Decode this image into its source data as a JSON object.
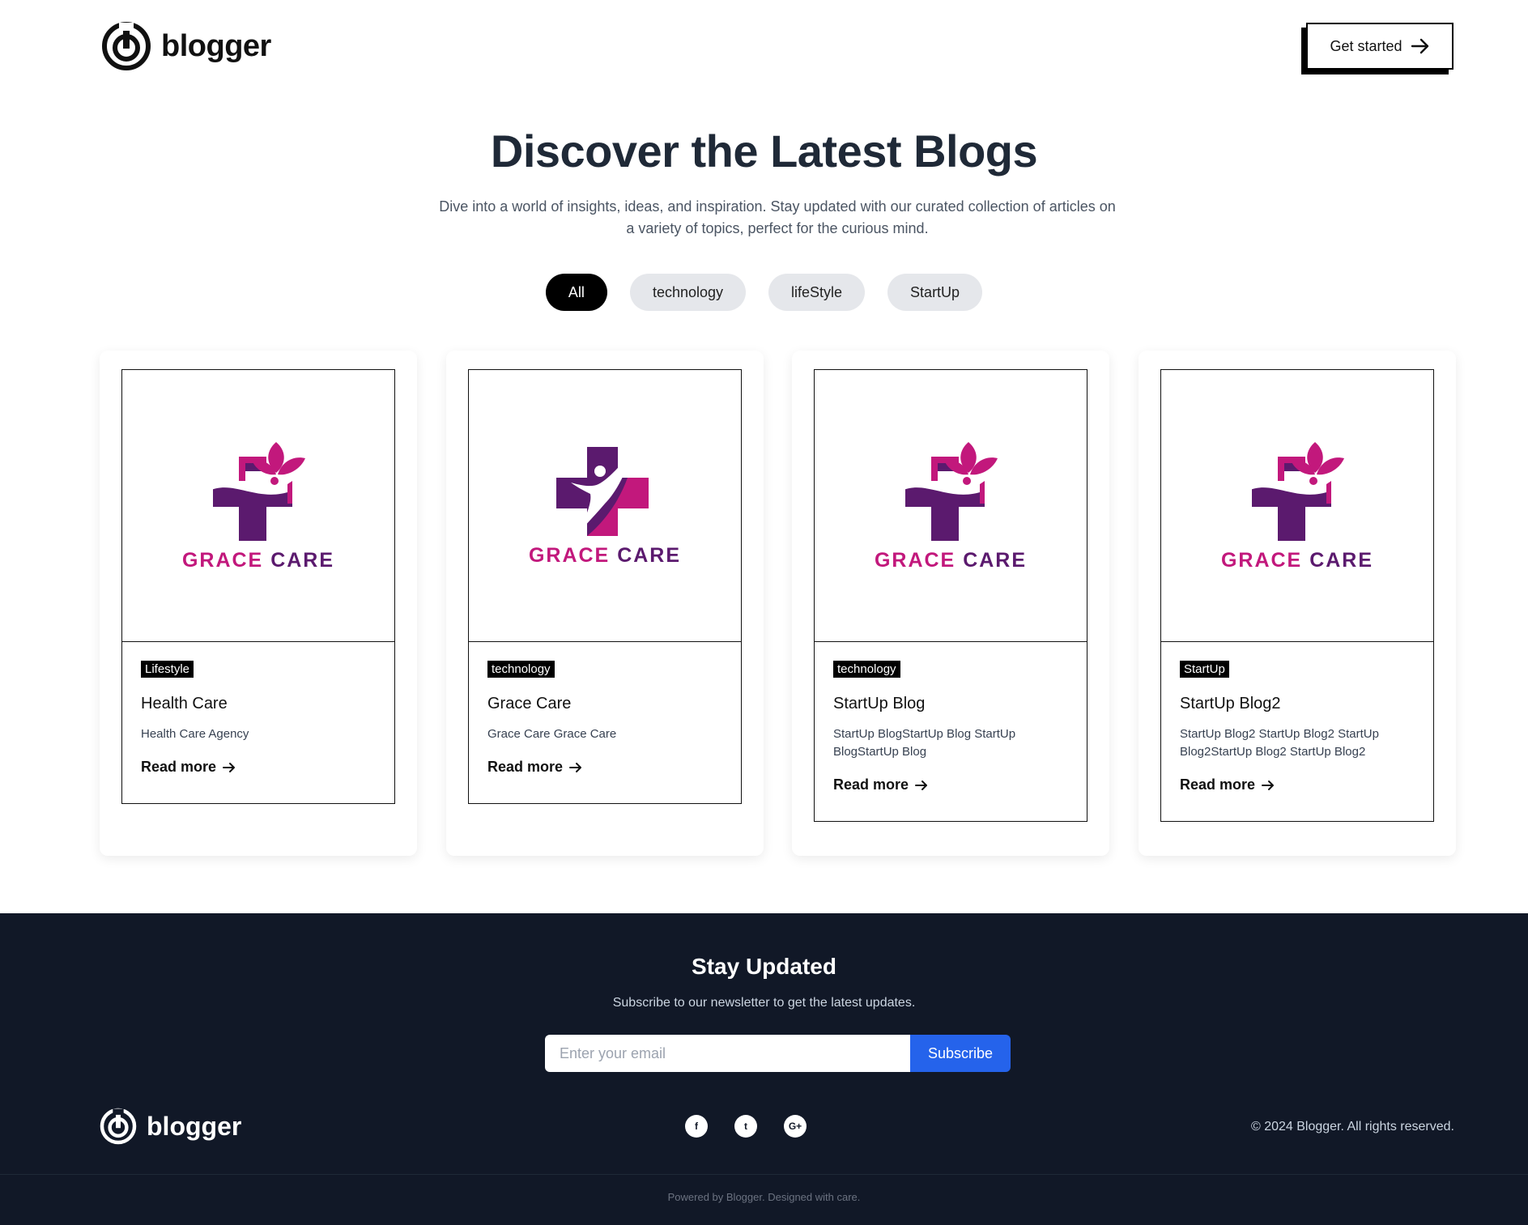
{
  "brand": {
    "name": "blogger"
  },
  "header": {
    "cta_label": "Get started"
  },
  "hero": {
    "title": "Discover the Latest Blogs",
    "subtitle_line1": "Dive into a world of insights, ideas, and inspiration. Stay updated with our curated collection of articles on",
    "subtitle_line2": "a variety of topics, perfect for the curious mind."
  },
  "filters": [
    {
      "label": "All",
      "active": true
    },
    {
      "label": "technology",
      "active": false
    },
    {
      "label": "lifeStyle",
      "active": false
    },
    {
      "label": "StartUp",
      "active": false
    }
  ],
  "cards": [
    {
      "logo_word1": "GRACE",
      "logo_word2": "CARE",
      "tag": "Lifestyle",
      "title": "Health Care",
      "desc": "Health Care Agency",
      "read_more": "Read more"
    },
    {
      "logo_word1": "GRACE",
      "logo_word2": "CARE",
      "tag": "technology",
      "title": "Grace Care",
      "desc": "Grace Care Grace Care",
      "read_more": "Read more"
    },
    {
      "logo_word1": "GRACE",
      "logo_word2": "CARE",
      "tag": "technology",
      "title": "StartUp Blog",
      "desc": "StartUp BlogStartUp Blog StartUp BlogStartUp Blog",
      "read_more": "Read more"
    },
    {
      "logo_word1": "GRACE",
      "logo_word2": "CARE",
      "tag": "StartUp",
      "title": "StartUp Blog2",
      "desc": "StartUp Blog2 StartUp Blog2 StartUp Blog2StartUp Blog2 StartUp Blog2",
      "read_more": "Read more"
    }
  ],
  "newsletter": {
    "title": "Stay Updated",
    "subtitle": "Subscribe to our newsletter to get the latest updates.",
    "email_placeholder": "Enter your email",
    "button_label": "Subscribe"
  },
  "footer": {
    "social_icons": [
      "facebook-icon",
      "twitter-icon",
      "google-plus-icon"
    ],
    "social_glyphs": [
      "f",
      "t",
      "G+"
    ],
    "copyright": "© 2024 Blogger. All rights reserved.",
    "powered": "Powered by Blogger. Designed with care."
  },
  "colors": {
    "accent_blue": "#2563eb",
    "footer_bg": "#111827",
    "logo_magenta": "#c2187c",
    "logo_purple": "#5b1a6e"
  }
}
